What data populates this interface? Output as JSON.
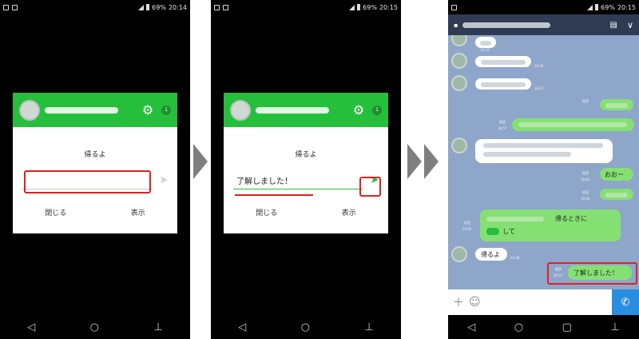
{
  "status": {
    "time1": "20:14",
    "time2": "20:15",
    "time3": "20:15",
    "battery": "69%"
  },
  "popup1": {
    "message": "帰るよ",
    "reply_value": "",
    "close_label": "閉じる",
    "show_label": "表示"
  },
  "popup2": {
    "message": "帰るよ",
    "reply_value": "了解しました！",
    "close_label": "閉じる",
    "show_label": "表示"
  },
  "chat": {
    "msg_ooh": "おおー",
    "msg_kaeru_tokini": "帰るときに",
    "msg_shite": "して",
    "msg_kaeruyo": "帰るよ",
    "msg_ryokai": "了解しました！",
    "t1": "18:19",
    "t2": "18:20",
    "t3": "18:21",
    "t4": "18:57",
    "t5": "19:02",
    "t6": "19:02",
    "t7": "19:02",
    "t8": "20:08",
    "t9": "20:15",
    "read": "既読"
  },
  "colors": {
    "line_green": "#26bf3c",
    "highlight_red": "#e02020",
    "chat_bg": "#8ea6c9",
    "chat_header": "#2f3b52",
    "bubble_green": "#85e073"
  },
  "nav": {
    "back": "◁",
    "home": "○",
    "recent": "▢",
    "extra": "⊥"
  }
}
